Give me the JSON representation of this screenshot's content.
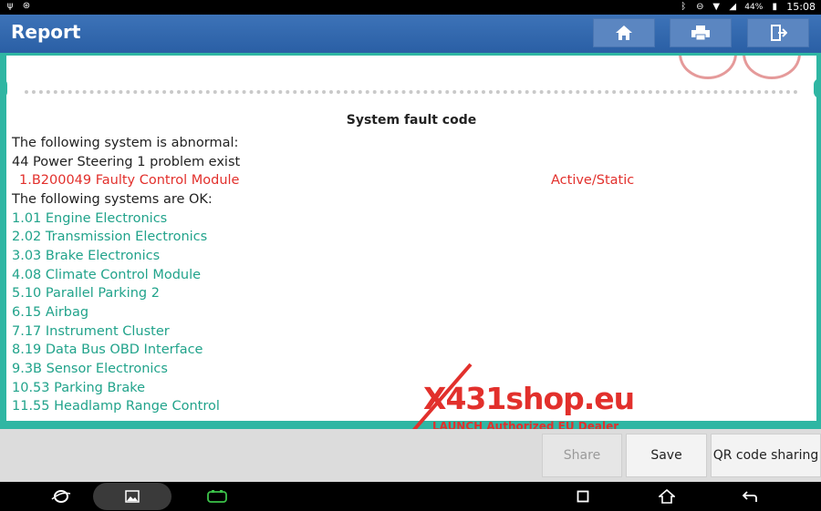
{
  "status_bar": {
    "battery": "44%",
    "time": "15:08"
  },
  "header": {
    "title": "Report"
  },
  "report": {
    "heading": "System fault code",
    "abnormal_intro": "The following system is abnormal:",
    "abnormal_system": "44 Power Steering 1 problem exist",
    "fault": {
      "code": "1.B200049 Faulty Control Module",
      "status": "Active/Static"
    },
    "ok_intro": "The following systems are OK:",
    "ok_systems": [
      "1.01 Engine Electronics",
      "2.02 Transmission Electronics",
      "3.03 Brake Electronics",
      "4.08 Climate Control Module",
      "5.10 Parallel Parking 2",
      "6.15 Airbag",
      "7.17 Instrument Cluster",
      "8.19 Data Bus OBD Interface",
      "9.3B Sensor Electronics",
      "10.53 Parking Brake",
      "11.55 Headlamp Range Control"
    ]
  },
  "watermark": {
    "x": "X",
    "brand": "431shop.eu",
    "tagline": "LAUNCH Authorized EU Dealer"
  },
  "actions": {
    "share": "Share",
    "save": "Save",
    "qr": "QR code sharing"
  },
  "colors": {
    "accent_blue": "#2a5fa5",
    "teal": "#21a38b",
    "fault_red": "#e2302c"
  }
}
